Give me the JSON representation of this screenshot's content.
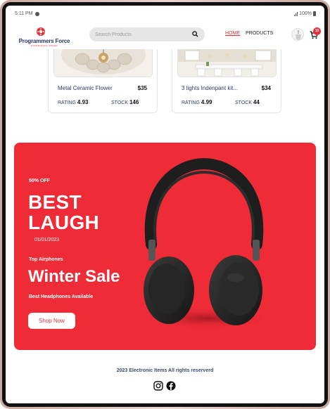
{
  "status_bar": {
    "time": "5:11 PM",
    "battery": "100%"
  },
  "header": {
    "logo_text": "Programmers Force",
    "logo_sub": "EXPERIENCE SPEED",
    "search_placeholder": "Search Products",
    "nav": {
      "home": "HOME",
      "products": "PRODUCTS"
    },
    "cart_count": "15"
  },
  "products": [
    {
      "name": "Metal Ceramic Flower",
      "price": "$35",
      "rating_label": "RATING",
      "rating": "4.93",
      "stock_label": "STOCK",
      "stock": "146"
    },
    {
      "name": "3 lights Indenpant kit...",
      "price": "$34",
      "rating_label": "RATING",
      "rating": "4.99",
      "stock_label": "STOCK",
      "stock": "44"
    }
  ],
  "banner": {
    "discount": "50% OFF",
    "title_line1": "BEST",
    "title_line2": "LAUGH",
    "date": "01/01/2023",
    "subtitle": "Top Airphones",
    "sale": "Winter Sale",
    "tagline": "Best Headphones Available",
    "button": "Shop Now",
    "bg_color": "#ef2b38"
  },
  "footer": {
    "copyright": "2023 Electronic Items All rights reserverd",
    "social_icons": [
      "instagram-icon",
      "facebook-icon"
    ]
  }
}
